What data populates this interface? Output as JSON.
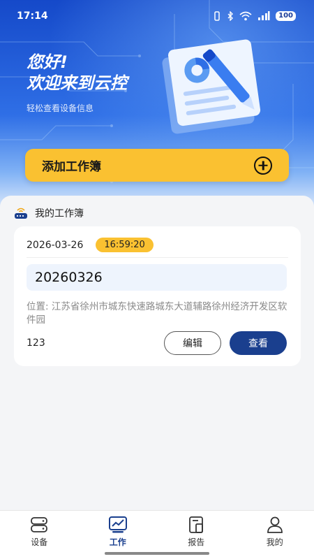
{
  "status": {
    "time": "17:14",
    "battery": "100"
  },
  "hero": {
    "greeting_line1": "您好!",
    "greeting_line2": "欢迎来到云控",
    "subtitle": "轻松查看设备信息",
    "add_button": "添加工作簿"
  },
  "section": {
    "title": "我的工作簿"
  },
  "workbook": {
    "date": "2026-03-26",
    "time": "16:59:20",
    "name": "20260326",
    "location": "位置: 江苏省徐州市城东快速路城东大道辅路徐州经济开发区软件园",
    "count": "123",
    "edit_label": "编辑",
    "view_label": "查看"
  },
  "tabs": [
    {
      "label": "设备",
      "icon": "device-icon"
    },
    {
      "label": "工作",
      "icon": "work-chart-icon",
      "active": true
    },
    {
      "label": "报告",
      "icon": "report-icon"
    },
    {
      "label": "我的",
      "icon": "user-icon"
    }
  ],
  "colors": {
    "accent": "#fac131",
    "primary": "#1a3f8e",
    "hero": "#1549c9"
  }
}
